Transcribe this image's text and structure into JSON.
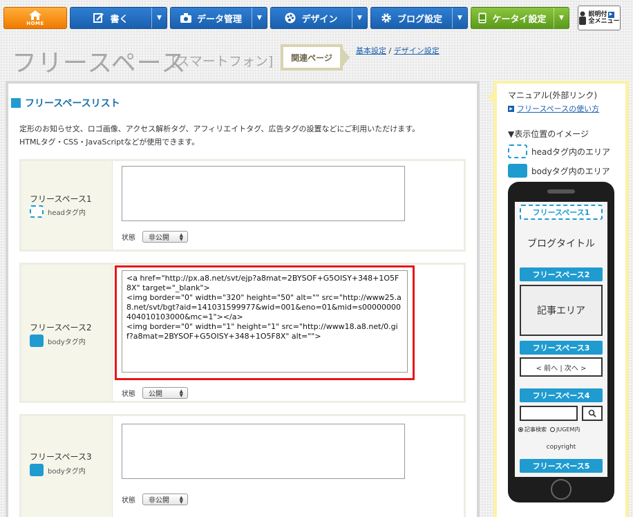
{
  "nav": {
    "home_label": "HOME",
    "items": [
      {
        "label": "書く"
      },
      {
        "label": "データ管理"
      },
      {
        "label": "デザイン"
      },
      {
        "label": "ブログ設定"
      },
      {
        "label": "ケータイ設定"
      }
    ],
    "manual_line1": "説明付",
    "manual_line2": "全メニュー"
  },
  "header": {
    "title": "フリースペース",
    "subtitle": "[スマートフォン]",
    "related_label": "関連ページ",
    "link_basic": "基本設定",
    "separator": " / ",
    "link_design": "デザイン設定"
  },
  "main": {
    "section_title": "フリースペースリスト",
    "desc_line1": "定形のお知らせ文、ロゴ画像、アクセス解析タグ、アフィリエイトタグ、広告タグの設置などにご利用いただけます。",
    "desc_line2": "HTMLタグ・CSS・JavaScriptなどが使用できます。",
    "state_label": "状態",
    "spaces": [
      {
        "name": "フリースペース1",
        "tag": "headタグ内",
        "content": "",
        "state": "非公開"
      },
      {
        "name": "フリースペース2",
        "tag": "bodyタグ内",
        "content": "<a href=\"http://px.a8.net/svt/ejp?a8mat=2BYSOF+G5OISY+348+1O5F8X\" target=\"_blank\">\n<img border=\"0\" width=\"320\" height=\"50\" alt=\"\" src=\"http://www25.a8.net/svt/bgt?aid=141031599977&wid=001&eno=01&mid=s00000000404010103000&mc=1\"></a>\n<img border=\"0\" width=\"1\" height=\"1\" src=\"http://www18.a8.net/0.gif?a8mat=2BYSOF+G5OISY+348+1O5F8X\" alt=\"\">",
        "state": "公開"
      },
      {
        "name": "フリースペース3",
        "tag": "bodyタグ内",
        "content": "",
        "state": "非公開"
      }
    ]
  },
  "sidebar": {
    "manual_head": "マニュアル(外部リンク)",
    "manual_link": "フリースペースの使い方",
    "position_head": "▼表示位置のイメージ",
    "legend_head": "headタグ内のエリア",
    "legend_body": "bodyタグ内のエリア",
    "phone": {
      "fs1": "フリースペース1",
      "blog_title": "ブログタイトル",
      "fs2": "フリースペース2",
      "article": "記事エリア",
      "fs3": "フリースペース3",
      "pager": "< 前へ | 次へ >",
      "fs4": "フリースペース4",
      "radio1": "記事検索",
      "radio2": "JUGEM内",
      "copyright": "copyright",
      "fs5": "フリースペース5"
    }
  },
  "colors": {
    "accent_blue": "#1f9bd0",
    "nav_blue": "#1a5fae",
    "home_orange": "#f07a00",
    "nav_green": "#5a9a1c",
    "highlight_red": "#e8161a"
  }
}
